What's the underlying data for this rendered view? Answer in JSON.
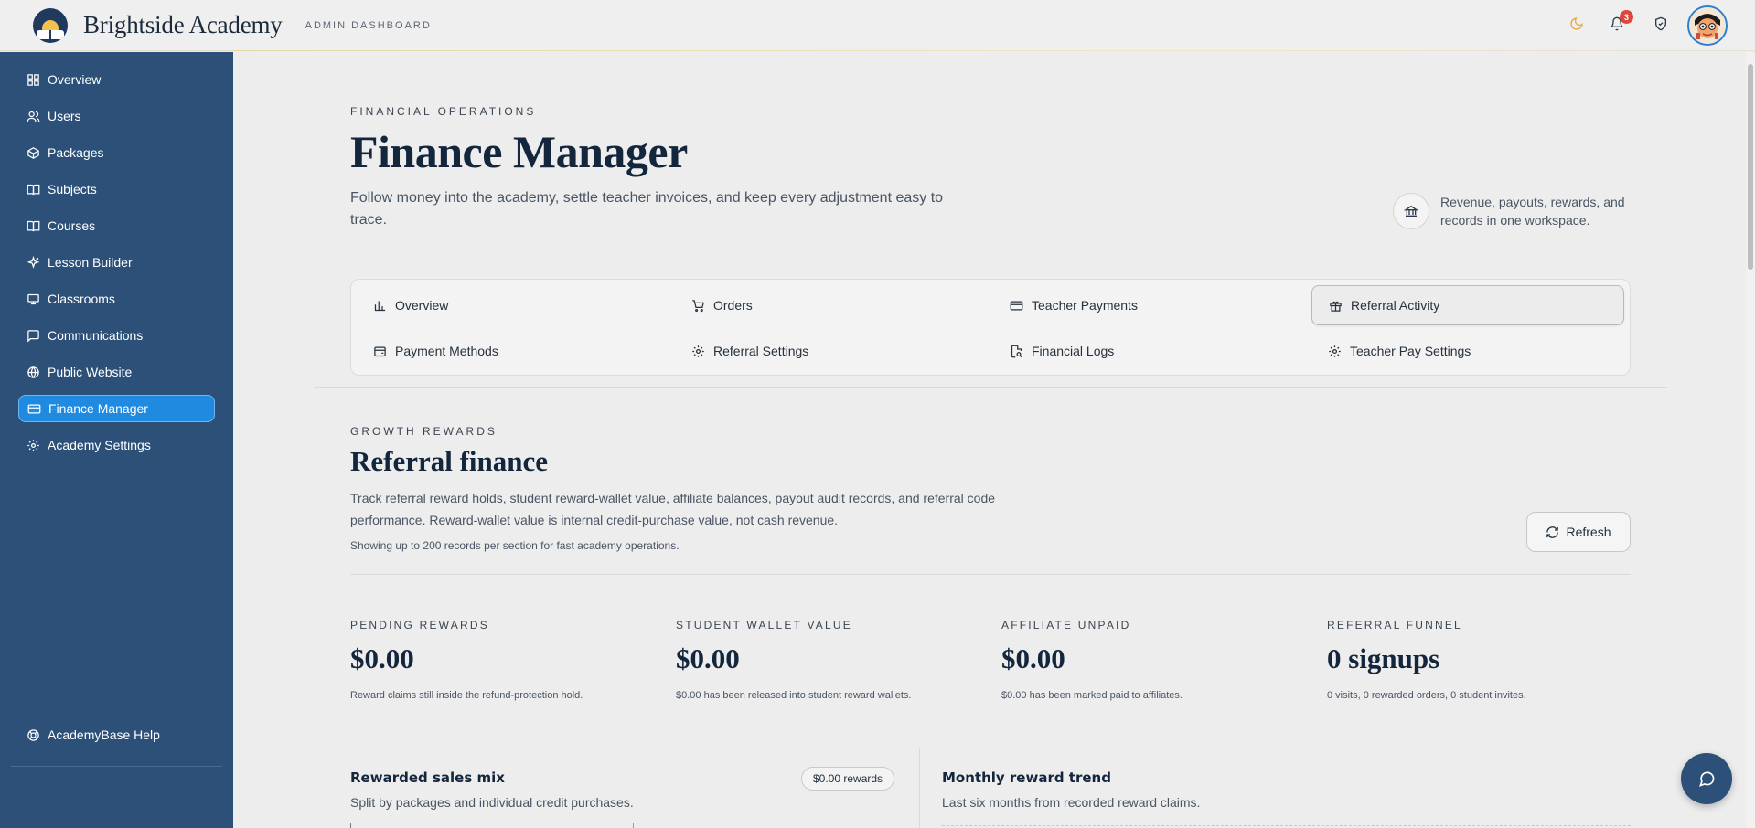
{
  "header": {
    "brand_name": "Brightside Academy",
    "brand_sub": "ADMIN DASHBOARD",
    "notification_count": "3",
    "colors": {
      "accent_gold": "#e8a93b",
      "sidebar": "#2c5078",
      "active": "#1f8ae0"
    }
  },
  "sidebar": {
    "items": [
      {
        "label": "Overview",
        "icon": "grid-icon"
      },
      {
        "label": "Users",
        "icon": "users-icon"
      },
      {
        "label": "Packages",
        "icon": "package-icon"
      },
      {
        "label": "Subjects",
        "icon": "book-icon"
      },
      {
        "label": "Courses",
        "icon": "book-open-icon"
      },
      {
        "label": "Lesson Builder",
        "icon": "sparkle-icon"
      },
      {
        "label": "Classrooms",
        "icon": "presentation-icon"
      },
      {
        "label": "Communications",
        "icon": "message-icon"
      },
      {
        "label": "Public Website",
        "icon": "globe-icon"
      },
      {
        "label": "Finance Manager",
        "icon": "credit-card-icon",
        "active": true
      },
      {
        "label": "Academy Settings",
        "icon": "gear-icon"
      }
    ],
    "help": "AcademyBase Help"
  },
  "hero": {
    "eyebrow": "FINANCIAL OPERATIONS",
    "title": "Finance Manager",
    "description": "Follow money into the academy, settle teacher invoices, and keep every adjustment easy to trace.",
    "side_text": "Revenue, payouts, rewards, and records in one workspace."
  },
  "tabs": [
    {
      "label": "Overview",
      "icon": "bar-chart-icon"
    },
    {
      "label": "Orders",
      "icon": "cart-icon"
    },
    {
      "label": "Teacher Payments",
      "icon": "credit-card-icon"
    },
    {
      "label": "Referral Activity",
      "icon": "gift-icon",
      "active": true
    },
    {
      "label": "Payment Methods",
      "icon": "wallet-icon"
    },
    {
      "label": "Referral Settings",
      "icon": "gear-icon"
    },
    {
      "label": "Financial Logs",
      "icon": "file-search-icon"
    },
    {
      "label": "Teacher Pay Settings",
      "icon": "gear-icon"
    }
  ],
  "section": {
    "eyebrow": "GROWTH REWARDS",
    "title": "Referral finance",
    "description": "Track referral reward holds, student reward-wallet value, affiliate balances, payout audit records, and referral code performance. Reward-wallet value is internal credit-purchase value, not cash revenue.",
    "note": "Showing up to 200 records per section for fast academy operations.",
    "refresh_label": "Refresh"
  },
  "stats": [
    {
      "label": "PENDING REWARDS",
      "value": "$0.00",
      "note": "Reward claims still inside the refund-protection hold."
    },
    {
      "label": "STUDENT WALLET VALUE",
      "value": "$0.00",
      "note": "$0.00 has been released into student reward wallets."
    },
    {
      "label": "AFFILIATE UNPAID",
      "value": "$0.00",
      "note": "$0.00 has been marked paid to affiliates."
    },
    {
      "label": "REFERRAL FUNNEL",
      "value": "0 signups",
      "note": "0 visits, 0 rewarded orders, 0 student invites."
    }
  ],
  "panels": {
    "sales_mix": {
      "title": "Rewarded sales mix",
      "subtitle": "Split by packages and individual credit purchases.",
      "pill": "$0.00 rewards"
    },
    "trend": {
      "title": "Monthly reward trend",
      "subtitle": "Last six months from recorded reward claims."
    }
  }
}
